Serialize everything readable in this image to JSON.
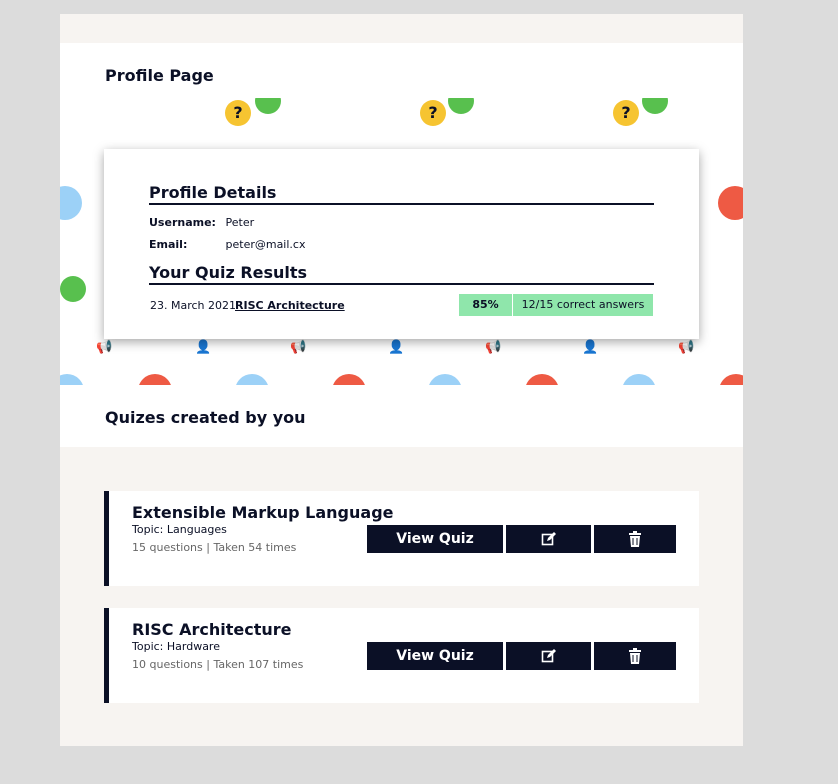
{
  "page": {
    "title": "Profile Page"
  },
  "profile": {
    "heading": "Profile Details",
    "username_label": "Username:",
    "username": "Peter",
    "email_label": "Email:",
    "email": "peter@mail.cx"
  },
  "results": {
    "heading": "Your Quiz Results",
    "items": [
      {
        "date": "23. March 2021",
        "quiz": "RISC Architecture",
        "percent": "85%",
        "answers": "12/15 correct answers"
      }
    ]
  },
  "created": {
    "heading": "Quizes created by you",
    "quizzes": [
      {
        "title": "Extensible Markup Language",
        "topic": "Topic: Languages",
        "meta": "15 questions | Taken 54 times",
        "view_label": "View Quiz"
      },
      {
        "title": "RISC Architecture",
        "topic": "Topic: Hardware",
        "meta": "10 questions | Taken 107 times",
        "view_label": "View Quiz"
      }
    ]
  },
  "colors": {
    "navy": "#0b1026",
    "success": "#8fe6ab",
    "band": "#f7f4f1"
  },
  "icons": {
    "edit": "edit-icon",
    "delete": "trash-icon"
  }
}
